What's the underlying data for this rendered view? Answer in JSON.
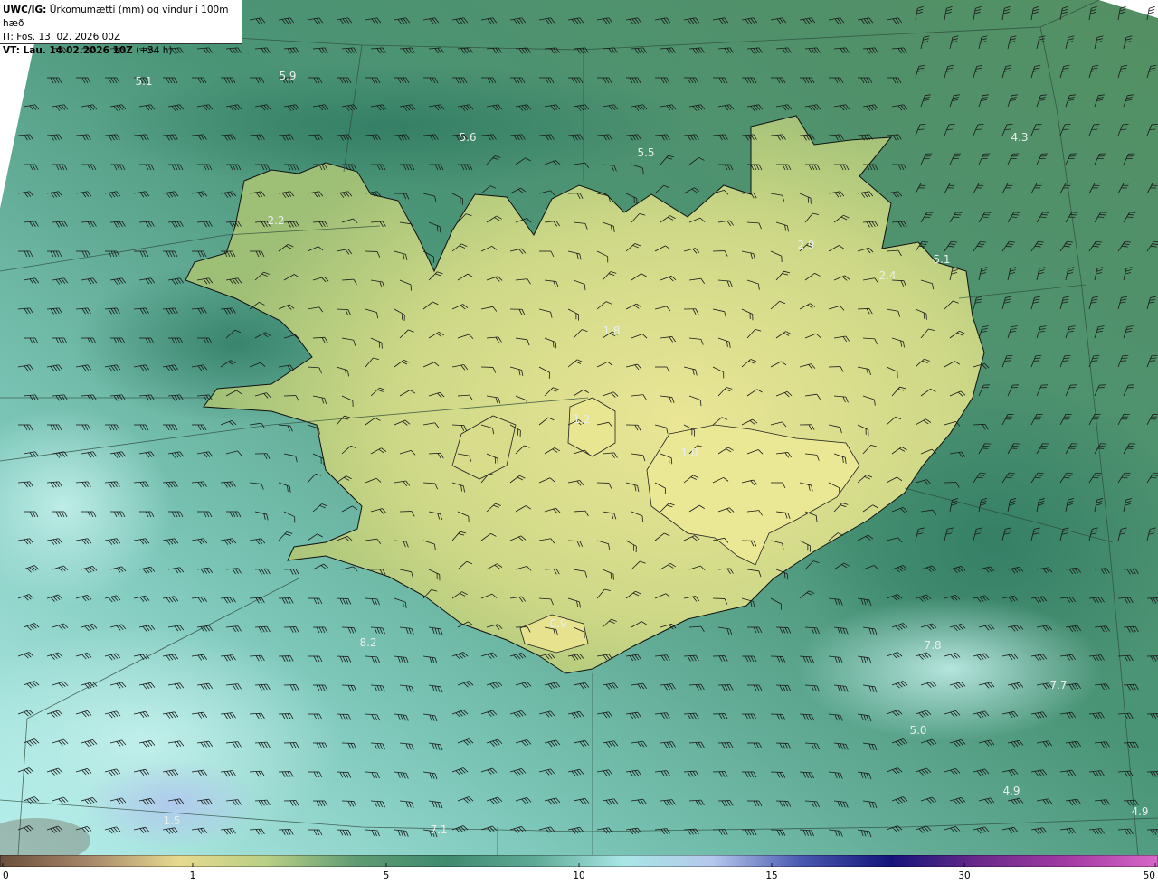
{
  "header": {
    "line1_bold": "UWC/IG:",
    "line1_rest": " Úrkomumætti (mm) og vindur í 100m hæð",
    "line2": "IT: Fös. 13. 02. 2026 00Z",
    "line3_bold": "VT: Lau. 14.02.2026 10Z",
    "line3_rest": " (+34 h)"
  },
  "map_values": [
    "5.1",
    "5.9",
    "5.6",
    "5.5",
    "4.3",
    "2.2",
    "2.9",
    "2.4",
    "5.1",
    "1.8",
    "1.0",
    "0.9",
    "8.2",
    "7.8",
    "7.7",
    "5.0",
    "4.9",
    "4.9",
    "7.1",
    "1.5",
    "1.2"
  ],
  "colorbar": {
    "ticks": [
      "0",
      "1",
      "5",
      "10",
      "15",
      "30",
      "50"
    ],
    "colors": [
      "#6b4f3b",
      "#a7876a",
      "#e6da8f",
      "#b8cf85",
      "#5f9b73",
      "#3f8a6e",
      "#5faa96",
      "#a8e6e6",
      "#b5c8ec",
      "#4a58b0",
      "#14147a",
      "#6a2a8a",
      "#a43aa4",
      "#d868c8"
    ]
  },
  "colors": {
    "land_high": "#e8e490",
    "land_low": "#9cbf7c",
    "sea_dark": "#3f8a6c",
    "sea_light": "#b2ece8",
    "coast": "#111111",
    "barb": "#1a1a1a"
  }
}
